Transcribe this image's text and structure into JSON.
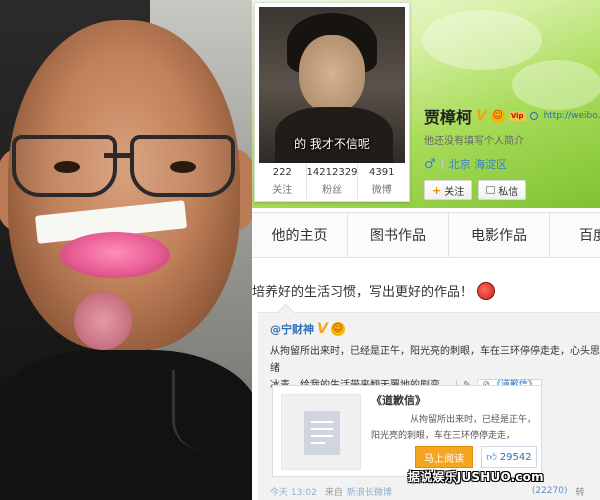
{
  "profile": {
    "avatar_caption": "的  我才不信呢",
    "stats": [
      {
        "value": "222",
        "label": "关注"
      },
      {
        "value": "14212329",
        "label": "粉丝"
      },
      {
        "value": "4391",
        "label": "微博"
      }
    ],
    "name": "贾樟柯",
    "verify_mark": "V",
    "vip_badge": "Vip",
    "url": "http://weibo.c",
    "intro": "他还没有填写个人简介",
    "gender_symbol": "♂",
    "location": "北京 海淀区",
    "follow_label": "关注",
    "message_label": "私信"
  },
  "tabs": [
    {
      "label": "他的主页"
    },
    {
      "label": "图书作品"
    },
    {
      "label": "电影作品"
    },
    {
      "label": "百度人"
    }
  ],
  "post": {
    "text": "培养好的生活习惯，写出更好的作品！",
    "repost": {
      "author": "@宁财神",
      "text_line1": "从拘留所出来时，已经是正午，阳光亮的刺眼，车在三环停停走走，心头思绪",
      "text_line2": "冰毒，给我的生活带来翻天覆地的剧变。",
      "link_label": "《道歉信》",
      "article": {
        "title": "《道歉信》",
        "line1": "从拘留所出来时，已经是正午，",
        "line2": "阳光亮的刺眼，车在三环停停走走，",
        "read_label": "马上阅读",
        "like_count": "29542"
      },
      "footer": {
        "time": "今天 13:02",
        "from": "来自",
        "client": "新浪长微博",
        "likes": "(22270)",
        "more": "转"
      }
    }
  },
  "watermark": "据说娱乐JUSHUO.com",
  "colors": {
    "link_blue": "#2a6fba",
    "read_orange": "#f7a421",
    "cover_green": "#a9dc5a"
  }
}
